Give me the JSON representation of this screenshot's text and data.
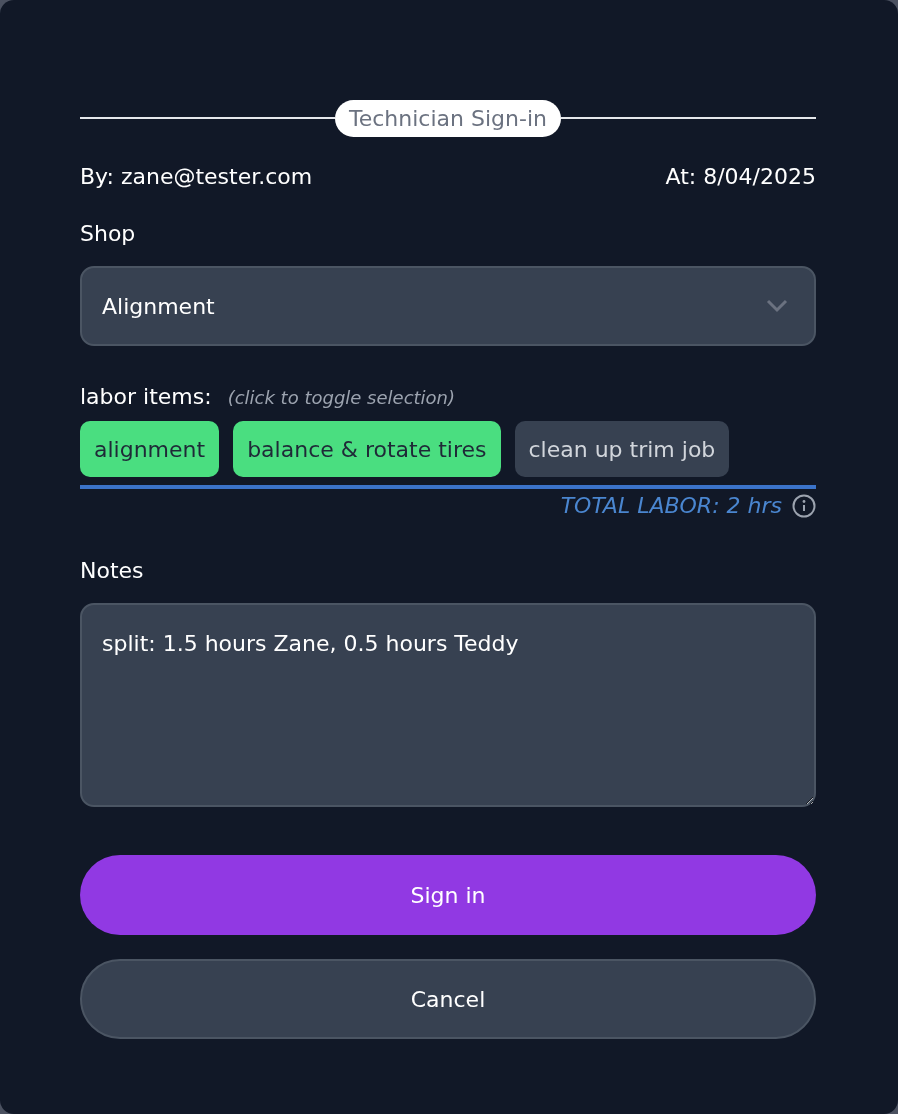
{
  "title": "Technician Sign-in",
  "by": "By: zane@tester.com",
  "at": "At: 8/04/2025",
  "shop": {
    "label": "Shop",
    "value": "Alignment"
  },
  "labor": {
    "label": "labor items:",
    "hint": "(click to toggle selection)",
    "items": [
      {
        "label": "alignment",
        "selected": true
      },
      {
        "label": "balance & rotate tires",
        "selected": true
      },
      {
        "label": "clean up trim job",
        "selected": false
      }
    ],
    "total": "TOTAL LABOR: 2 hrs"
  },
  "notes": {
    "label": "Notes",
    "value": "split: 1.5 hours Zane, 0.5 hours Teddy"
  },
  "buttons": [
    {
      "label": "Sign in",
      "kind": "primary"
    },
    {
      "label": "Cancel",
      "kind": "secondary"
    }
  ]
}
